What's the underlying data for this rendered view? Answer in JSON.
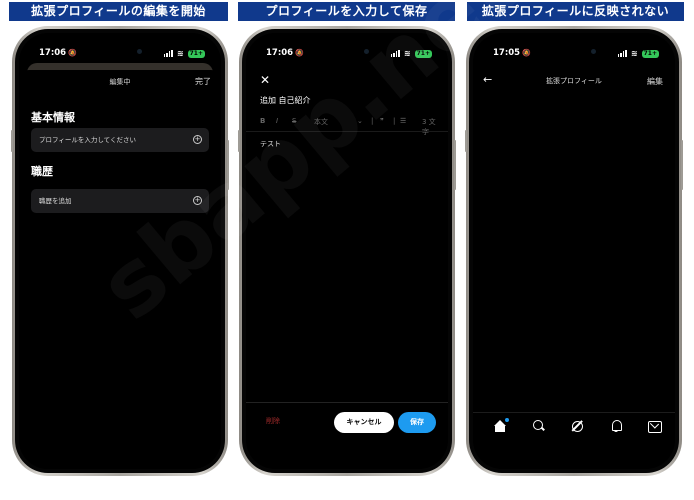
{
  "banners": [
    "拡張プロフィールの編集を開始",
    "プロフィールを入力して保存",
    "拡張プロフィールに反映されない"
  ],
  "phone1": {
    "time": "17:06",
    "battery": "71+",
    "title": "編集中",
    "done": "完了",
    "section_basic": "基本情報",
    "basic_field": "プロフィールを入力してください",
    "section_job": "職歴",
    "job_field": "職歴を追加"
  },
  "phone2": {
    "time": "17:06",
    "battery": "71+",
    "title": "追加 自己紹介",
    "toolbar": {
      "bold": "B",
      "italic": "I",
      "strike": "S",
      "style": "本文",
      "count": "3 文字"
    },
    "body": "テスト",
    "delete": "削除",
    "cancel": "キャンセル",
    "save": "保存"
  },
  "phone3": {
    "time": "17:05",
    "battery": "71+",
    "title": "拡張プロフィール",
    "edit": "編集"
  },
  "watermark": "sbapp.net",
  "colors": {
    "banner": "#10398c",
    "accent": "#1d9bf0",
    "delete": "#a12a2a",
    "battery": "#34c759"
  }
}
